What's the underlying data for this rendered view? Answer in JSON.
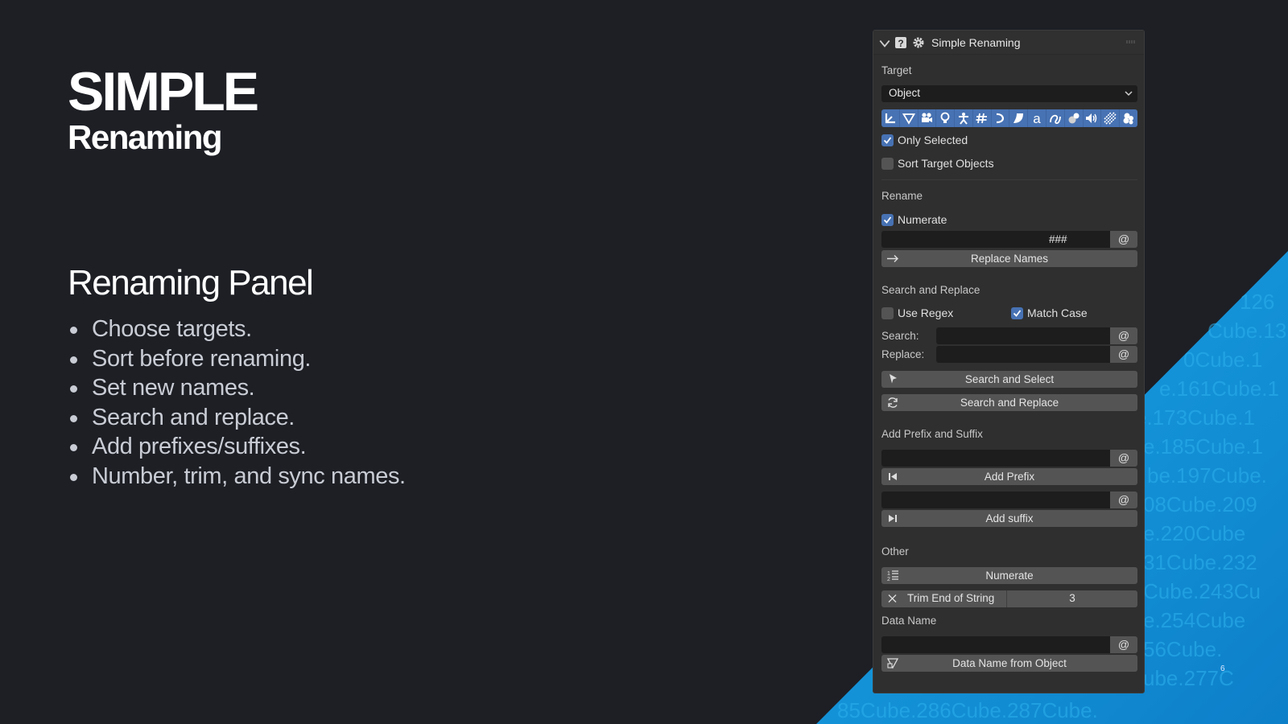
{
  "slide": {
    "title": "SIMPLE",
    "subtitle": "Renaming",
    "section_title": "Renaming Panel",
    "bullets": [
      "Choose targets.",
      "Sort before renaming.",
      "Set new names.",
      "Search and replace.",
      "Add prefixes/suffixes.",
      "Number, trim, and sync names."
    ],
    "page_number": "6",
    "accent_color": "#1e9fe0"
  },
  "panel": {
    "title": "Simple Renaming",
    "target": {
      "label": "Target",
      "dropdown_value": "Object",
      "type_icons": [
        "armature-icon",
        "mesh-icon",
        "camera-icon",
        "light-icon",
        "bone-icon",
        "lattice-icon",
        "curve-icon",
        "surface-icon",
        "text-icon",
        "greasepencil-icon",
        "metaball-icon",
        "speaker-icon",
        "volume-icon",
        "pointcloud-icon"
      ],
      "only_selected_label": "Only Selected",
      "only_selected": true,
      "sort_label": "Sort Target Objects",
      "sort": false
    },
    "rename": {
      "label": "Rename",
      "numerate_label": "Numerate",
      "numerate": true,
      "name_value": "",
      "number_format": "###",
      "at_label": "@",
      "replace_button": "Replace Names"
    },
    "search_replace": {
      "label": "Search and Replace",
      "use_regex_label": "Use Regex",
      "use_regex": false,
      "match_case_label": "Match Case",
      "match_case": true,
      "search_label": "Search:",
      "replace_label": "Replace:",
      "search_select_button": "Search and Select",
      "search_replace_button": "Search and Replace"
    },
    "prefix_suffix": {
      "label": "Add Prefix and Suffix",
      "add_prefix_button": "Add Prefix",
      "add_suffix_button": "Add suffix"
    },
    "other": {
      "label": "Other",
      "numerate_button": "Numerate",
      "trim_label": "Trim End of String",
      "trim_value": "3"
    },
    "data_name": {
      "label": "Data Name",
      "button": "Data Name from Object"
    }
  }
}
